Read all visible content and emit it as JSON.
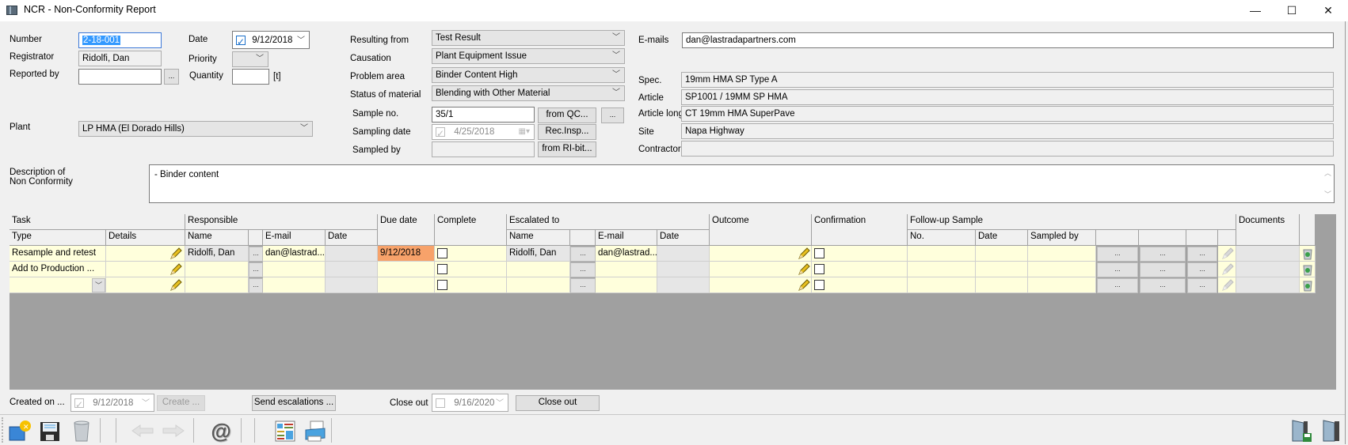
{
  "window": {
    "title": "NCR - Non-Conformity Report",
    "minimize": "—",
    "maximize": "☐",
    "close": "✕"
  },
  "form": {
    "number_label": "Number",
    "number_value": "2-18-001",
    "registrator_label": "Registrator",
    "registrator_value": "Ridolfi, Dan",
    "reported_by_label": "Reported by",
    "reported_by_value": "",
    "browse": "...",
    "date_label": "Date",
    "date_value": "9/12/2018",
    "date_checked": true,
    "priority_label": "Priority",
    "priority_value": "",
    "quantity_label": "Quantity",
    "quantity_value": "",
    "quantity_unit": "[t]",
    "plant_label": "Plant",
    "plant_value": "LP HMA (El Dorado Hills)",
    "resulting_from_label": "Resulting from",
    "resulting_from_value": "Test Result",
    "causation_label": "Causation",
    "causation_value": "Plant Equipment Issue",
    "problem_area_label": "Problem area",
    "problem_area_value": "Binder Content High",
    "status_material_label": "Status of material",
    "status_material_value": "Blending with Other Material",
    "sample_no_label": "Sample no.",
    "sample_no_value": "35/1",
    "from_qc_button": "from QC...",
    "sample_browse": "...",
    "sampling_date_label": "Sampling date",
    "sampling_date_value": "4/25/2018",
    "rec_insp_button": "Rec.Insp...",
    "sampled_by_label": "Sampled by",
    "sampled_by_value": "",
    "from_ri_bit_button": "from RI-bit...",
    "emails_label": "E-mails",
    "emails_value": "dan@lastradapartners.com",
    "spec_label": "Spec.",
    "spec_value": "19mm HMA SP Type A",
    "article_label": "Article",
    "article_value": "SP1001 / 19MM SP HMA",
    "article_long_label": "Article long",
    "article_long_value": "CT 19mm HMA SuperPave",
    "site_label": "Site",
    "site_value": "Napa Highway",
    "contractor_label": "Contractor",
    "contractor_value": "",
    "description_label_1": "Description of",
    "description_label_2": "Non Conformity",
    "description_value": "- Binder content"
  },
  "grid": {
    "group_headers": {
      "task": "Task",
      "responsible": "Responsible",
      "due_date": "Due date",
      "complete": "Complete",
      "escalated_to": "Escalated to",
      "outcome": "Outcome",
      "confirmation": "Confirmation",
      "follow_up_sample": "Follow-up Sample",
      "documents": "Documents"
    },
    "sub_headers": {
      "type": "Type",
      "details": "Details",
      "resp_name": "Name",
      "resp_email": "E-mail",
      "resp_date": "Date",
      "esc_name": "Name",
      "esc_email": "E-mail",
      "esc_date": "Date",
      "fu_no": "No.",
      "fu_date": "Date",
      "fu_sampled_by": "Sampled by"
    },
    "rows": [
      {
        "type": "Resample and retest",
        "details": "",
        "resp_name": "Ridolfi, Dan",
        "resp_email": "dan@lastrad...",
        "resp_date": "",
        "due_date": "9/12/2018",
        "complete": false,
        "esc_name": "Ridolfi, Dan",
        "esc_email": "dan@lastrad...",
        "esc_date": "",
        "outcome": "",
        "confirmation": false,
        "fu_no": "",
        "fu_date": "",
        "fu_sampled_by": "",
        "documents": ""
      },
      {
        "type": "Add to Production ...",
        "details": "",
        "resp_name": "",
        "resp_email": "",
        "resp_date": "",
        "due_date": "",
        "complete": false,
        "esc_name": "",
        "esc_email": "",
        "esc_date": "",
        "outcome": "",
        "confirmation": false,
        "fu_no": "",
        "fu_date": "",
        "fu_sampled_by": "",
        "documents": ""
      },
      {
        "type": "",
        "details": "",
        "resp_name": "",
        "resp_email": "",
        "resp_date": "",
        "due_date": "",
        "complete": false,
        "esc_name": "",
        "esc_email": "",
        "esc_date": "",
        "outcome": "",
        "confirmation": false,
        "fu_no": "",
        "fu_date": "",
        "fu_sampled_by": "",
        "documents": ""
      }
    ],
    "ellipsis": "...",
    "due_date_highlight": "#f7a26a"
  },
  "footer": {
    "created_on_label": "Created on ...",
    "created_on_value": "9/12/2018",
    "create_button": "Create ...",
    "send_escalations_button": "Send escalations ...",
    "close_out_label": "Close out",
    "close_out_date": "9/16/2020",
    "close_out_button": "Close out"
  },
  "toolbar": {
    "icons": [
      "new-icon",
      "save-icon",
      "delete-icon",
      "back-arrow-icon",
      "forward-arrow-icon",
      "email-icon",
      "report-icon",
      "print-icon",
      "save-and-exit-icon",
      "exit-icon"
    ],
    "email_glyph": "@"
  }
}
